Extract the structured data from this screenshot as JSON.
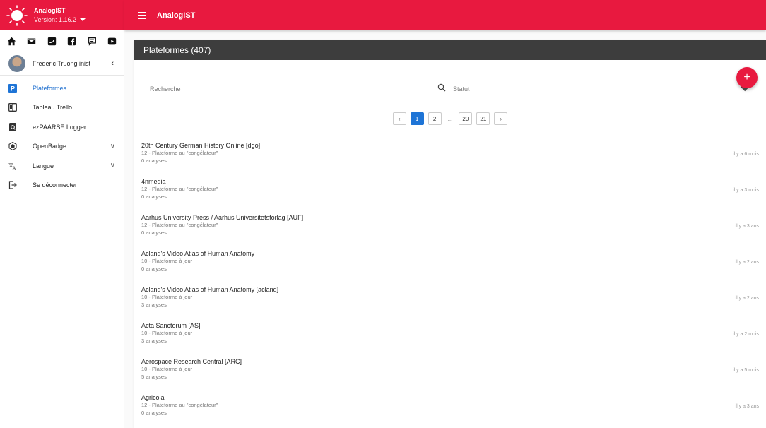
{
  "sidebar": {
    "brand_name": "AnalogIST",
    "version": "Version: 1.16.2",
    "social_icons": [
      "home-icon",
      "mail-icon",
      "twitter-icon",
      "facebook-icon",
      "chat-icon",
      "youtube-icon"
    ],
    "user_name": "Frederic Truong inist",
    "items": [
      {
        "label": "Plateformes",
        "icon": "plateformes-icon",
        "active": true
      },
      {
        "label": "Tableau Trello",
        "icon": "trello-icon"
      },
      {
        "label": "ezPAARSE Logger",
        "icon": "logger-icon"
      },
      {
        "label": "OpenBadge",
        "icon": "badge-icon",
        "expandable": true
      },
      {
        "label": "Langue",
        "icon": "translate-icon",
        "expandable": true
      },
      {
        "label": "Se déconnecter",
        "icon": "logout-icon"
      }
    ]
  },
  "topbar": {
    "title": "AnalogIST"
  },
  "main": {
    "title": "Plateformes (407)",
    "add_label": "+",
    "search": {
      "placeholder": "Recherche"
    },
    "status": {
      "placeholder": "Statut"
    },
    "pagination": [
      "1",
      "2",
      "...",
      "20",
      "21"
    ],
    "rows": [
      {
        "title": "20th Century German History Online [dgo]",
        "status": "12 - Plateforme au \"congélateur\"",
        "count": "0 analyses",
        "date": "il y a 6 mois"
      },
      {
        "title": "4nmedia",
        "status": "12 - Plateforme au \"congélateur\"",
        "count": "0 analyses",
        "date": "il y a 3 mois"
      },
      {
        "title": "Aarhus University Press / Aarhus Universitetsforlag [AUF]",
        "status": "12 - Plateforme au \"congélateur\"",
        "count": "0 analyses",
        "date": "il y a 3 ans"
      },
      {
        "title": "Acland's Video Atlas of Human Anatomy",
        "status": "10 - Plateforme à jour",
        "count": "0 analyses",
        "date": "il y a 2 ans"
      },
      {
        "title": "Acland's Video Atlas of Human Anatomy [acland]",
        "status": "10 - Plateforme à jour",
        "count": "3 analyses",
        "date": "il y a 2 ans"
      },
      {
        "title": "Acta Sanctorum [AS]",
        "status": "10 - Plateforme à jour",
        "count": "3 analyses",
        "date": "il y a 2 mois"
      },
      {
        "title": "Aerospace Research Central [ARC]",
        "status": "10 - Plateforme à jour",
        "count": "5 analyses",
        "date": "il y a 5 mois"
      },
      {
        "title": "Agricola",
        "status": "12 - Plateforme au \"congélateur\"",
        "count": "0 analyses",
        "date": "il y a 3 ans"
      }
    ]
  },
  "colors": {
    "accent": "#e8193f",
    "header_dark": "#3d3d3d",
    "link_blue": "#1e74d6"
  }
}
